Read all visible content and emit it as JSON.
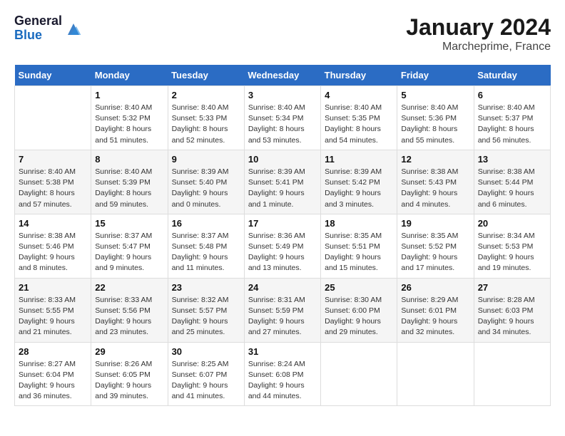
{
  "logo": {
    "general": "General",
    "blue": "Blue"
  },
  "title": "January 2024",
  "subtitle": "Marcheprime, France",
  "days_of_week": [
    "Sunday",
    "Monday",
    "Tuesday",
    "Wednesday",
    "Thursday",
    "Friday",
    "Saturday"
  ],
  "weeks": [
    [
      {
        "day": "",
        "info": ""
      },
      {
        "day": "1",
        "info": "Sunrise: 8:40 AM\nSunset: 5:32 PM\nDaylight: 8 hours\nand 51 minutes."
      },
      {
        "day": "2",
        "info": "Sunrise: 8:40 AM\nSunset: 5:33 PM\nDaylight: 8 hours\nand 52 minutes."
      },
      {
        "day": "3",
        "info": "Sunrise: 8:40 AM\nSunset: 5:34 PM\nDaylight: 8 hours\nand 53 minutes."
      },
      {
        "day": "4",
        "info": "Sunrise: 8:40 AM\nSunset: 5:35 PM\nDaylight: 8 hours\nand 54 minutes."
      },
      {
        "day": "5",
        "info": "Sunrise: 8:40 AM\nSunset: 5:36 PM\nDaylight: 8 hours\nand 55 minutes."
      },
      {
        "day": "6",
        "info": "Sunrise: 8:40 AM\nSunset: 5:37 PM\nDaylight: 8 hours\nand 56 minutes."
      }
    ],
    [
      {
        "day": "7",
        "info": "Sunrise: 8:40 AM\nSunset: 5:38 PM\nDaylight: 8 hours\nand 57 minutes."
      },
      {
        "day": "8",
        "info": "Sunrise: 8:40 AM\nSunset: 5:39 PM\nDaylight: 8 hours\nand 59 minutes."
      },
      {
        "day": "9",
        "info": "Sunrise: 8:39 AM\nSunset: 5:40 PM\nDaylight: 9 hours\nand 0 minutes."
      },
      {
        "day": "10",
        "info": "Sunrise: 8:39 AM\nSunset: 5:41 PM\nDaylight: 9 hours\nand 1 minute."
      },
      {
        "day": "11",
        "info": "Sunrise: 8:39 AM\nSunset: 5:42 PM\nDaylight: 9 hours\nand 3 minutes."
      },
      {
        "day": "12",
        "info": "Sunrise: 8:38 AM\nSunset: 5:43 PM\nDaylight: 9 hours\nand 4 minutes."
      },
      {
        "day": "13",
        "info": "Sunrise: 8:38 AM\nSunset: 5:44 PM\nDaylight: 9 hours\nand 6 minutes."
      }
    ],
    [
      {
        "day": "14",
        "info": "Sunrise: 8:38 AM\nSunset: 5:46 PM\nDaylight: 9 hours\nand 8 minutes."
      },
      {
        "day": "15",
        "info": "Sunrise: 8:37 AM\nSunset: 5:47 PM\nDaylight: 9 hours\nand 9 minutes."
      },
      {
        "day": "16",
        "info": "Sunrise: 8:37 AM\nSunset: 5:48 PM\nDaylight: 9 hours\nand 11 minutes."
      },
      {
        "day": "17",
        "info": "Sunrise: 8:36 AM\nSunset: 5:49 PM\nDaylight: 9 hours\nand 13 minutes."
      },
      {
        "day": "18",
        "info": "Sunrise: 8:35 AM\nSunset: 5:51 PM\nDaylight: 9 hours\nand 15 minutes."
      },
      {
        "day": "19",
        "info": "Sunrise: 8:35 AM\nSunset: 5:52 PM\nDaylight: 9 hours\nand 17 minutes."
      },
      {
        "day": "20",
        "info": "Sunrise: 8:34 AM\nSunset: 5:53 PM\nDaylight: 9 hours\nand 19 minutes."
      }
    ],
    [
      {
        "day": "21",
        "info": "Sunrise: 8:33 AM\nSunset: 5:55 PM\nDaylight: 9 hours\nand 21 minutes."
      },
      {
        "day": "22",
        "info": "Sunrise: 8:33 AM\nSunset: 5:56 PM\nDaylight: 9 hours\nand 23 minutes."
      },
      {
        "day": "23",
        "info": "Sunrise: 8:32 AM\nSunset: 5:57 PM\nDaylight: 9 hours\nand 25 minutes."
      },
      {
        "day": "24",
        "info": "Sunrise: 8:31 AM\nSunset: 5:59 PM\nDaylight: 9 hours\nand 27 minutes."
      },
      {
        "day": "25",
        "info": "Sunrise: 8:30 AM\nSunset: 6:00 PM\nDaylight: 9 hours\nand 29 minutes."
      },
      {
        "day": "26",
        "info": "Sunrise: 8:29 AM\nSunset: 6:01 PM\nDaylight: 9 hours\nand 32 minutes."
      },
      {
        "day": "27",
        "info": "Sunrise: 8:28 AM\nSunset: 6:03 PM\nDaylight: 9 hours\nand 34 minutes."
      }
    ],
    [
      {
        "day": "28",
        "info": "Sunrise: 8:27 AM\nSunset: 6:04 PM\nDaylight: 9 hours\nand 36 minutes."
      },
      {
        "day": "29",
        "info": "Sunrise: 8:26 AM\nSunset: 6:05 PM\nDaylight: 9 hours\nand 39 minutes."
      },
      {
        "day": "30",
        "info": "Sunrise: 8:25 AM\nSunset: 6:07 PM\nDaylight: 9 hours\nand 41 minutes."
      },
      {
        "day": "31",
        "info": "Sunrise: 8:24 AM\nSunset: 6:08 PM\nDaylight: 9 hours\nand 44 minutes."
      },
      {
        "day": "",
        "info": ""
      },
      {
        "day": "",
        "info": ""
      },
      {
        "day": "",
        "info": ""
      }
    ]
  ]
}
